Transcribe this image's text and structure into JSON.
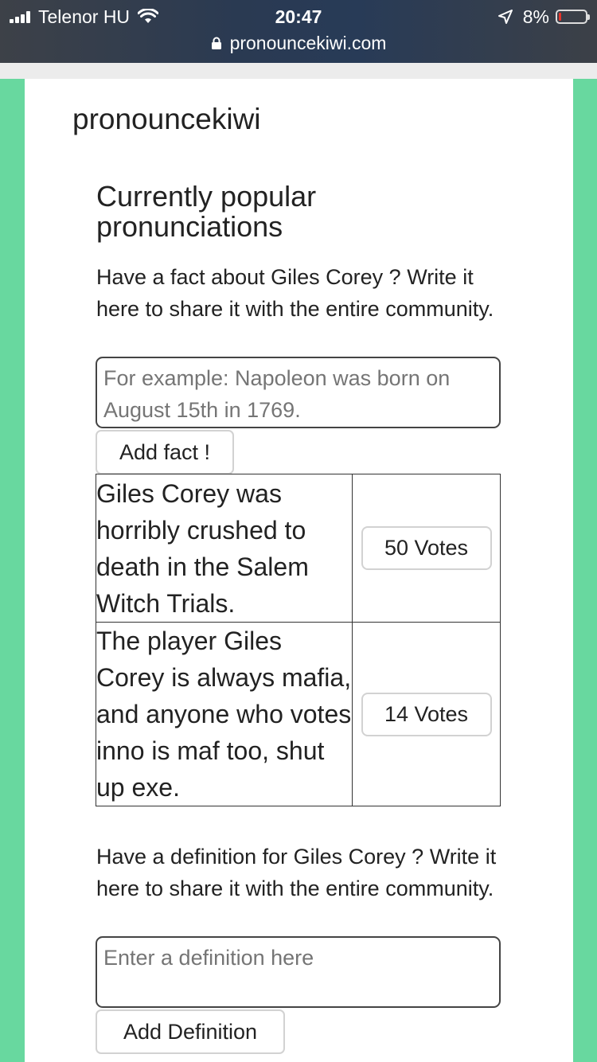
{
  "status_bar": {
    "carrier": "Telenor HU",
    "time": "20:47",
    "battery": "8%",
    "battery_level": 0.08,
    "battery_color": "#e5342a",
    "url": "pronouncekiwi.com"
  },
  "site": {
    "brand": "pronouncekiwi",
    "accent_color": "#68d89f"
  },
  "popular": {
    "heading": "Currently popular pronunciations"
  },
  "fact_section": {
    "prompt": "Have a fact about Giles Corey ? Write it here to share it with the entire community.",
    "placeholder": "For example: Napoleon was born on August 15th in 1769.",
    "button": "Add fact !"
  },
  "facts": [
    {
      "text": "Giles Corey was horribly crushed to death in the Salem Witch Trials.",
      "votes": "50 Votes"
    },
    {
      "text": "The player Giles Corey is always mafia, and anyone who votes inno is maf too, shut up exe.",
      "votes": "14 Votes"
    }
  ],
  "definition_section": {
    "prompt": "Have a definition for Giles Corey ? Write it here to share it with the entire community.",
    "placeholder": "Enter a definition here",
    "button": "Add Definition"
  }
}
